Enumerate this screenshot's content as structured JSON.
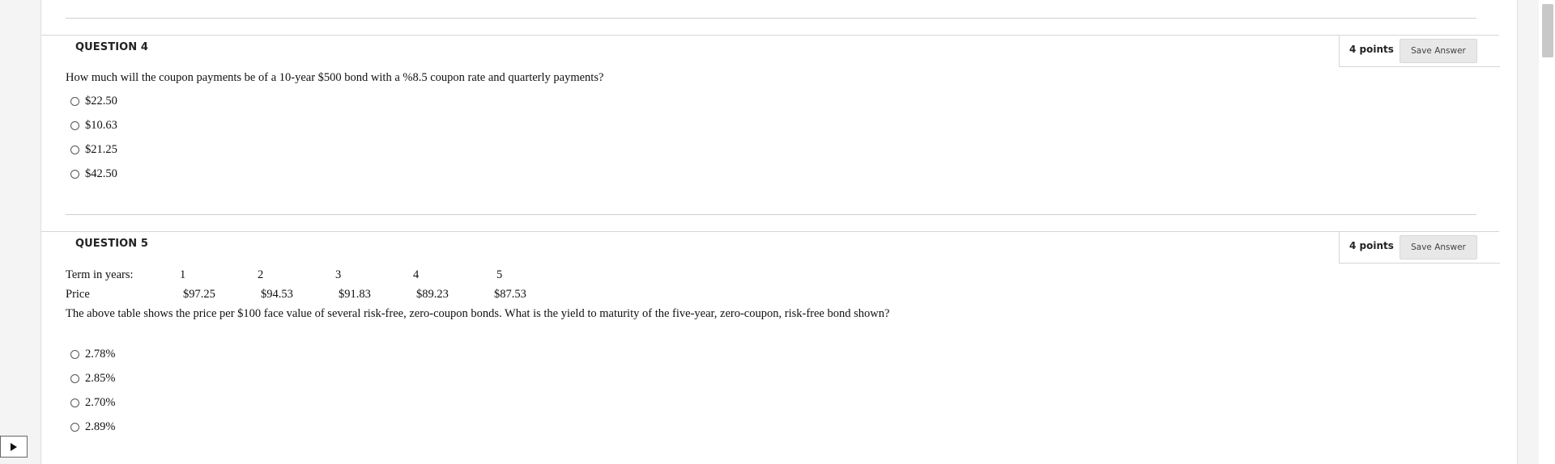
{
  "question4": {
    "title": "QUESTION 4",
    "points": "4 points",
    "save_label": "Save Answer",
    "text": "How much will the coupon payments be of a 10-year $500 bond with a %8.5 coupon rate and quarterly payments?",
    "options": [
      "$22.50",
      "$10.63",
      "$21.25",
      "$42.50"
    ]
  },
  "question5": {
    "title": "QUESTION 5",
    "points": "4 points",
    "save_label": "Save Answer",
    "table": {
      "row_label_term": "Term in years:",
      "row_label_price": "Price",
      "terms": [
        "1",
        "2",
        "3",
        "4",
        "5"
      ],
      "prices": [
        "$97.25",
        "$94.53",
        "$91.83",
        "$89.23",
        "$87.53"
      ]
    },
    "text": "The above table shows the price per $100 face value of several risk-free, zero-coupon bonds. What is the yield to maturity of the five-year, zero-coupon, risk-free bond shown?",
    "options": [
      "2.78%",
      "2.85%",
      "2.70%",
      "2.89%"
    ]
  }
}
